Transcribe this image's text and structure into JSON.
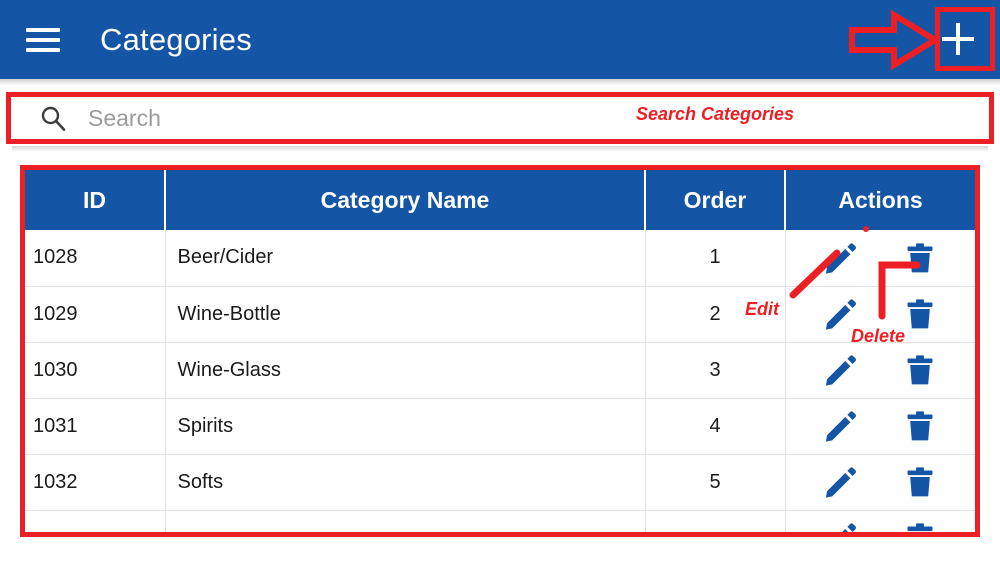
{
  "appbar": {
    "menu_icon": "hamburger-menu-icon",
    "title": "Categories",
    "add_icon": "plus-icon",
    "add_label": "+"
  },
  "search": {
    "icon": "search-icon",
    "value": "",
    "placeholder": "Search"
  },
  "annotations": {
    "search_note": "Search Categories",
    "edit_note": "Edit",
    "delete_note": "Delete",
    "highlight_color": "#ec2024",
    "arrow_icon": "right-arrow-annotation-icon"
  },
  "table": {
    "columns": [
      "ID",
      "Category Name",
      "Order",
      "Actions"
    ],
    "rows": [
      {
        "id": "1028",
        "name": "Beer/Cider",
        "order": "1",
        "edit_icon": "pencil-icon",
        "delete_icon": "trash-icon"
      },
      {
        "id": "1029",
        "name": "Wine-Bottle",
        "order": "2",
        "edit_icon": "pencil-icon",
        "delete_icon": "trash-icon"
      },
      {
        "id": "1030",
        "name": "Wine-Glass",
        "order": "3",
        "edit_icon": "pencil-icon",
        "delete_icon": "trash-icon"
      },
      {
        "id": "1031",
        "name": "Spirits",
        "order": "4",
        "edit_icon": "pencil-icon",
        "delete_icon": "trash-icon"
      },
      {
        "id": "1032",
        "name": "Softs",
        "order": "5",
        "edit_icon": "pencil-icon",
        "delete_icon": "trash-icon"
      },
      {
        "id": "",
        "name": "",
        "order": "",
        "edit_icon": "pencil-icon",
        "delete_icon": "trash-icon"
      }
    ]
  },
  "theme": {
    "primary_blue": "#1455a5",
    "icon_blue": "#1455a5",
    "annotation_red": "#ec2024"
  }
}
